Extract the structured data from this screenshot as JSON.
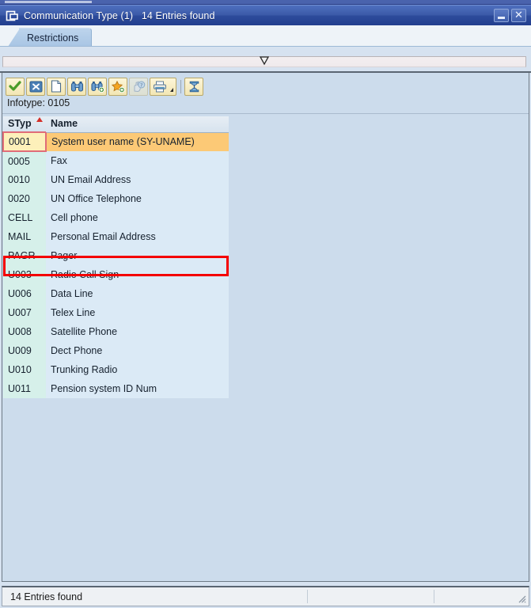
{
  "window": {
    "title": "Communication Type (1)   14 Entries found",
    "title_icon": "popup-window-icon",
    "minimize_label": "Minimize",
    "close_label": "Close"
  },
  "tabs": [
    {
      "label": "Restrictions",
      "name": "tab-restrictions",
      "active": true
    }
  ],
  "restriction_bar": {
    "caret_icon": "chevron-down-icon",
    "value": ""
  },
  "toolbar": {
    "buttons": [
      {
        "name": "copy-button",
        "icon": "check-green-icon",
        "title": "Copy",
        "disabled": false
      },
      {
        "name": "cancel-button",
        "icon": "cancel-x-icon",
        "title": "Cancel",
        "disabled": false
      },
      {
        "name": "new-selection-button",
        "icon": "blank-page-icon",
        "title": "New Selection",
        "disabled": false
      },
      {
        "name": "find-button",
        "icon": "binoculars-icon",
        "title": "Find",
        "disabled": false
      },
      {
        "name": "find-next-button",
        "icon": "binoculars-plus-icon",
        "title": "Find Next",
        "disabled": false
      },
      {
        "name": "insert-favorite-button",
        "icon": "star-plus-icon",
        "title": "Insert in Personal Value List",
        "disabled": false
      },
      {
        "name": "help-button",
        "icon": "hand-help-icon",
        "title": "Help",
        "disabled": true
      },
      {
        "name": "print-button",
        "icon": "printer-icon",
        "title": "Print",
        "disabled": false
      },
      {
        "name": "personal-values-button",
        "icon": "personal-list-icon",
        "title": "Display Personal Value List",
        "disabled": false
      }
    ]
  },
  "infotype": {
    "label": "Infotype: 0105"
  },
  "results": {
    "columns": [
      {
        "key": "styp",
        "label": "STyp",
        "sorted": "ascending"
      },
      {
        "key": "name",
        "label": "Name",
        "sorted": ""
      }
    ],
    "rows": [
      {
        "styp": "0001",
        "name": "System user name (SY-UNAME)",
        "selected": true,
        "annotated": false
      },
      {
        "styp": "0005",
        "name": "Fax",
        "selected": false,
        "annotated": false
      },
      {
        "styp": "0010",
        "name": "UN Email Address",
        "selected": false,
        "annotated": true
      },
      {
        "styp": "0020",
        "name": "UN Office Telephone",
        "selected": false,
        "annotated": false
      },
      {
        "styp": "CELL",
        "name": "Cell phone",
        "selected": false,
        "annotated": false
      },
      {
        "styp": "MAIL",
        "name": "Personal Email Address",
        "selected": false,
        "annotated": false
      },
      {
        "styp": "PAGR",
        "name": "Pager",
        "selected": false,
        "annotated": false
      },
      {
        "styp": "U003",
        "name": "Radio Call Sign",
        "selected": false,
        "annotated": false
      },
      {
        "styp": "U006",
        "name": "Data Line",
        "selected": false,
        "annotated": false
      },
      {
        "styp": "U007",
        "name": "Telex Line",
        "selected": false,
        "annotated": false
      },
      {
        "styp": "U008",
        "name": "Satellite Phone",
        "selected": false,
        "annotated": false
      },
      {
        "styp": "U009",
        "name": "Dect Phone",
        "selected": false,
        "annotated": false
      },
      {
        "styp": "U010",
        "name": "Trunking Radio",
        "selected": false,
        "annotated": false
      },
      {
        "styp": "U011",
        "name": "Pension system ID Num",
        "selected": false,
        "annotated": false
      }
    ]
  },
  "annotation": {
    "color": "#f40000",
    "target_row_styp": "0010"
  },
  "statusbar": {
    "message": "14 Entries found",
    "resize_grip_icon": "resize-grip-icon"
  },
  "colors": {
    "titlebar_start": "#4e6fbe",
    "titlebar_end": "#223e8e",
    "panel_bg": "#ccdcec",
    "styp_cell_bg": "#d6f0ea",
    "name_cell_bg": "#dbeaf6",
    "selected_name_bg": "#fcc976",
    "selected_styp_bg": "#fdf0ba",
    "selection_border": "#e06c78",
    "sort_arrow": "#d4302a",
    "annotation": "#f40000"
  }
}
